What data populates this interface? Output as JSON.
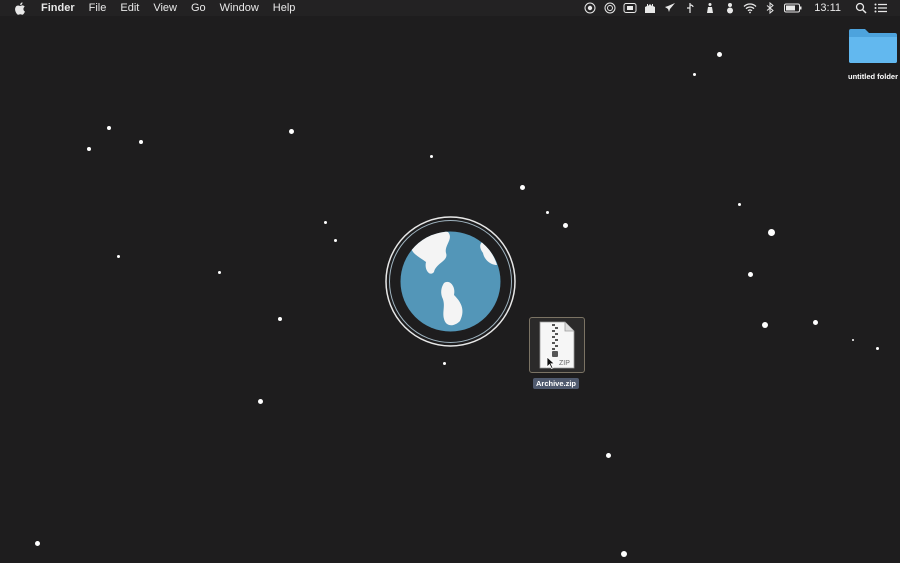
{
  "menubar": {
    "app_name": "Finder",
    "items": [
      "File",
      "Edit",
      "View",
      "Go",
      "Window",
      "Help"
    ],
    "clock": "13:11",
    "status_icons": [
      "record-icon",
      "target-icon",
      "screen-icon",
      "castle-icon",
      "rocket-icon",
      "cursor-icon",
      "figure-icon",
      "snowman-icon",
      "wifi-icon",
      "bluetooth-icon",
      "battery-icon"
    ]
  },
  "desktop": {
    "folder_label": "untitled folder",
    "zip_label": "Archive.zip",
    "zip_badge": "ZIP"
  },
  "colors": {
    "background": "#1e1d1e",
    "menubar": "#232223",
    "globe_ocean": "#5396b8",
    "folder_blue": "#62b8ef",
    "selection_label": "#505a6e"
  }
}
